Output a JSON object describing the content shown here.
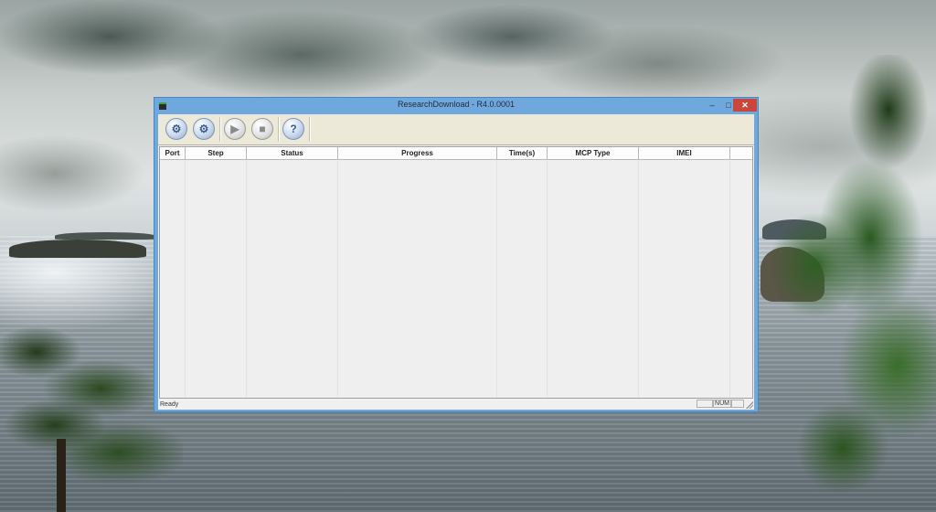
{
  "window": {
    "title": "ResearchDownload - R4.0.0001",
    "minimize_glyph": "–",
    "maximize_glyph": "□",
    "close_glyph": "✕"
  },
  "toolbar": {
    "buttons": [
      {
        "icon": "gear-icon",
        "glyph": "⚙"
      },
      {
        "icon": "gears-icon",
        "glyph": "⚙"
      },
      {
        "icon": "play-icon",
        "glyph": "▶"
      },
      {
        "icon": "stop-icon",
        "glyph": "■"
      },
      {
        "icon": "help-icon",
        "glyph": "?"
      }
    ]
  },
  "table": {
    "columns": [
      "Port",
      "Step",
      "Status",
      "Progress",
      "Time(s)",
      "MCP Type",
      "IMEI"
    ]
  },
  "statusbar": {
    "text": "Ready",
    "num": "NUM"
  }
}
